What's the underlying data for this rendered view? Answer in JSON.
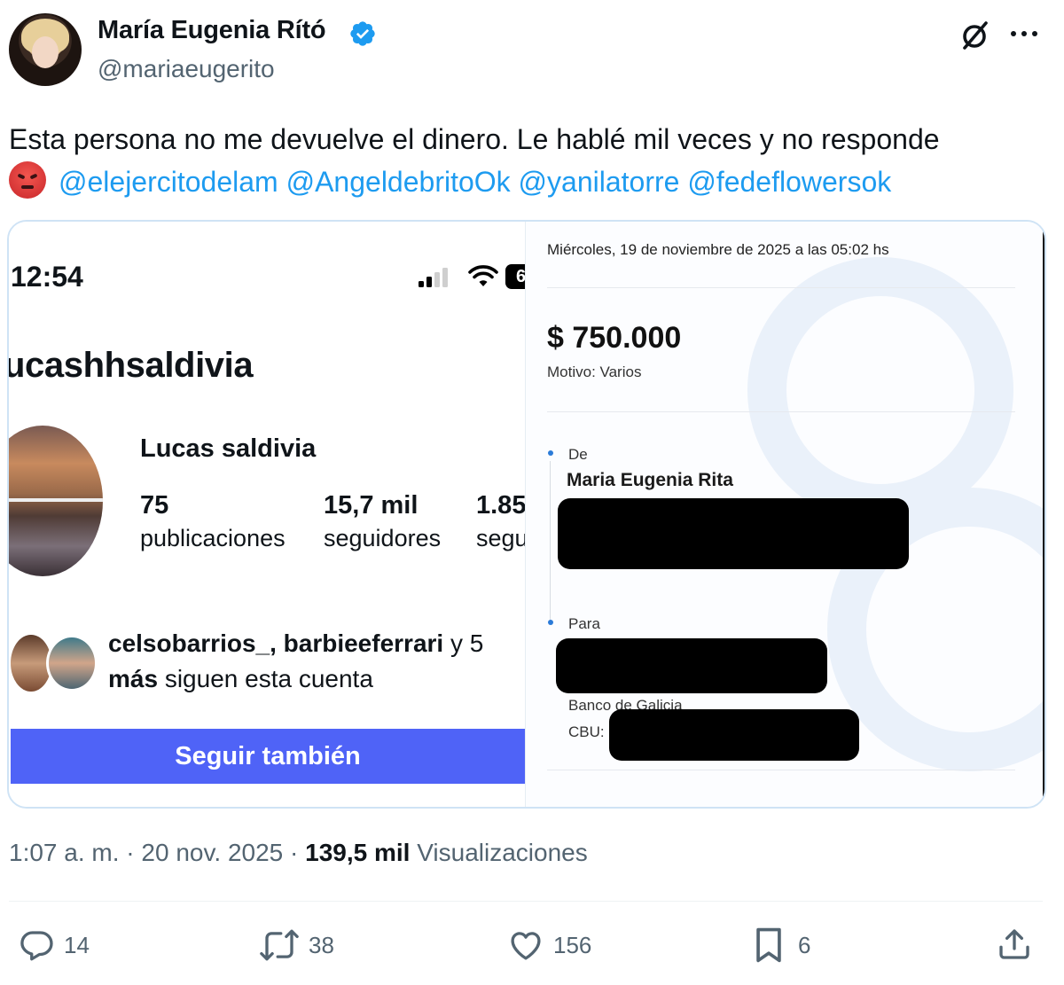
{
  "author": {
    "display_name": "María Eugenia Rító",
    "handle": "@mariaeugerito"
  },
  "tweet": {
    "text_before": "Esta persona no me devuelve el dinero. Le hablé mil veces y no responde",
    "emoji": "angry-face",
    "mentions": [
      "@elejercitodelam",
      "@AngeldebritoOk",
      "@yanilatorre",
      "@fedeflowersok"
    ]
  },
  "media": {
    "left": {
      "time": "12:54",
      "battery": "6",
      "username": "ucashhsaldivia",
      "full_name": "Lucas saldivia",
      "stats": [
        {
          "num": "75",
          "label": "publicaciones"
        },
        {
          "num": "15,7 mil",
          "label": "seguidores"
        },
        {
          "num": "1.85",
          "label": "segu"
        }
      ],
      "followed_by_names": "celsobarrios_, barbieeferrari",
      "followed_by_y": " y 5",
      "followed_by_mas": "más",
      "followed_by_rest": " siguen esta cuenta",
      "follow_button": "Seguir también"
    },
    "right": {
      "date": "Miércoles, 19 de noviembre de 2025 a las 05:02 hs",
      "amount": "$ 750.000",
      "motivo": "Motivo: Varios",
      "from_label": "De",
      "from_name": "Maria Eugenia Rita",
      "to_label": "Para",
      "bank": "Banco de Galicia",
      "cbu_label": "CBU:"
    }
  },
  "meta": {
    "time": "1:07 a. m.",
    "sep": " · ",
    "date": "20 nov. 2025",
    "views_count": "139,5 mil",
    "views_label": "Visualizaciones"
  },
  "actions": {
    "replies": "14",
    "reposts": "38",
    "likes": "156",
    "bookmarks": "6"
  },
  "colors": {
    "accent": "#1d9bf0",
    "follow_button": "#4f63f7",
    "secondary_text": "#536471"
  }
}
